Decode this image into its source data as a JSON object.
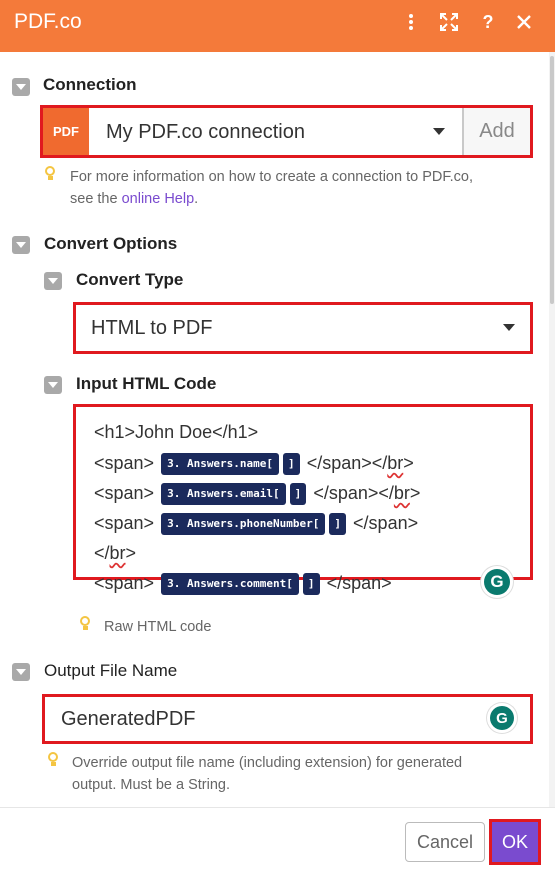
{
  "header": {
    "title": "PDF.co",
    "icons": [
      "more-vertical-icon",
      "fullscreen-icon",
      "help-icon",
      "close-icon"
    ]
  },
  "connection": {
    "section_label": "Connection",
    "badge": "PDF",
    "selected": "My PDF.co connection",
    "add_label": "Add",
    "hint_before": "For more information on how to create a connection to PDF.co,",
    "hint_see": "see the",
    "hint_link": "online Help",
    "hint_after": "."
  },
  "convert_options": {
    "section_label": "Convert Options",
    "convert_type": {
      "label": "Convert Type",
      "selected": "HTML to PDF"
    },
    "input_html": {
      "label": "Input HTML Code",
      "line1": "<h1>John Doe</h1>",
      "span_open": "<span>",
      "span_close": "</span>",
      "br": "br",
      "br_open": "</",
      "br_close": ">",
      "chip_name": "3. Answers.name[",
      "chip_email": "3. Answers.email[",
      "chip_phone": "3. Answers.phoneNumber[",
      "chip_comment": "3. Answers.comment[",
      "chip_end": "]",
      "hint": "Raw HTML code"
    }
  },
  "output_file": {
    "label": "Output File Name",
    "value": "GeneratedPDF",
    "hint_line1": "Override output file name (including extension) for generated",
    "hint_line2": "output. Must be a String."
  },
  "footer": {
    "cancel_label": "Cancel",
    "ok_label": "OK"
  },
  "colors": {
    "header_bg": "#f47a3a",
    "highlight_border": "#e0191f",
    "ok_button": "#7a4bcf",
    "chip_bg": "#1b2a5c"
  }
}
